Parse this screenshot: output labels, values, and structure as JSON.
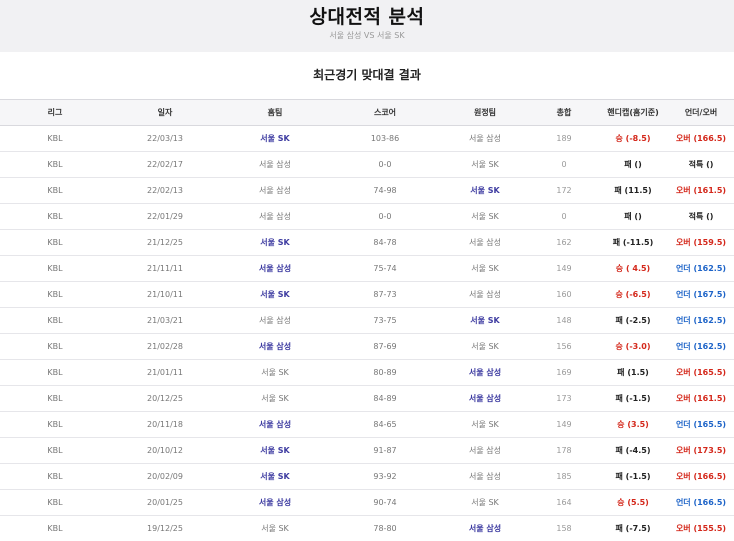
{
  "header": {
    "title": "상대전적 분석",
    "subtitle": "서울 삼성 VS 서울 SK"
  },
  "section_title": "최근경기 맞대결 결과",
  "columns": [
    "리그",
    "일자",
    "홈팀",
    "스코어",
    "원정팀",
    "총합",
    "핸디캡(홈기준)",
    "언더/오버"
  ],
  "rows": [
    {
      "league": "KBL",
      "date": "22/03/13",
      "home": "서울 SK",
      "home_strong": true,
      "score": "103-86",
      "away": "서울 삼성",
      "away_strong": false,
      "total": "189",
      "hc_result": "승",
      "hc_value": "(-8.5)",
      "hc_type": "win",
      "ou": "오버 (166.5)",
      "ou_type": "over"
    },
    {
      "league": "KBL",
      "date": "22/02/17",
      "home": "서울 삼성",
      "home_strong": false,
      "score": "0-0",
      "away": "서울 SK",
      "away_strong": false,
      "total": "0",
      "hc_result": "패",
      "hc_value": "()",
      "hc_type": "lose",
      "ou": "적특 ()",
      "ou_type": "exact"
    },
    {
      "league": "KBL",
      "date": "22/02/13",
      "home": "서울 삼성",
      "home_strong": false,
      "score": "74-98",
      "away": "서울 SK",
      "away_strong": true,
      "total": "172",
      "hc_result": "패",
      "hc_value": "(11.5)",
      "hc_type": "lose",
      "ou": "오버 (161.5)",
      "ou_type": "over"
    },
    {
      "league": "KBL",
      "date": "22/01/29",
      "home": "서울 삼성",
      "home_strong": false,
      "score": "0-0",
      "away": "서울 SK",
      "away_strong": false,
      "total": "0",
      "hc_result": "패",
      "hc_value": "()",
      "hc_type": "lose",
      "ou": "적특 ()",
      "ou_type": "exact"
    },
    {
      "league": "KBL",
      "date": "21/12/25",
      "home": "서울 SK",
      "home_strong": true,
      "score": "84-78",
      "away": "서울 삼성",
      "away_strong": false,
      "total": "162",
      "hc_result": "패",
      "hc_value": "(-11.5)",
      "hc_type": "lose",
      "ou": "오버 (159.5)",
      "ou_type": "over"
    },
    {
      "league": "KBL",
      "date": "21/11/11",
      "home": "서울 삼성",
      "home_strong": true,
      "score": "75-74",
      "away": "서울 SK",
      "away_strong": false,
      "total": "149",
      "hc_result": "승",
      "hc_value": "( 4.5)",
      "hc_type": "win",
      "ou": "언더 (162.5)",
      "ou_type": "under"
    },
    {
      "league": "KBL",
      "date": "21/10/11",
      "home": "서울 SK",
      "home_strong": true,
      "score": "87-73",
      "away": "서울 삼성",
      "away_strong": false,
      "total": "160",
      "hc_result": "승",
      "hc_value": "(-6.5)",
      "hc_type": "win",
      "ou": "언더 (167.5)",
      "ou_type": "under"
    },
    {
      "league": "KBL",
      "date": "21/03/21",
      "home": "서울 삼성",
      "home_strong": false,
      "score": "73-75",
      "away": "서울 SK",
      "away_strong": true,
      "total": "148",
      "hc_result": "패",
      "hc_value": "(-2.5)",
      "hc_type": "lose",
      "ou": "언더 (162.5)",
      "ou_type": "under"
    },
    {
      "league": "KBL",
      "date": "21/02/28",
      "home": "서울 삼성",
      "home_strong": true,
      "score": "87-69",
      "away": "서울 SK",
      "away_strong": false,
      "total": "156",
      "hc_result": "승",
      "hc_value": "(-3.0)",
      "hc_type": "win",
      "ou": "언더 (162.5)",
      "ou_type": "under"
    },
    {
      "league": "KBL",
      "date": "21/01/11",
      "home": "서울 SK",
      "home_strong": false,
      "score": "80-89",
      "away": "서울 삼성",
      "away_strong": true,
      "total": "169",
      "hc_result": "패",
      "hc_value": "(1.5)",
      "hc_type": "lose",
      "ou": "오버 (165.5)",
      "ou_type": "over"
    },
    {
      "league": "KBL",
      "date": "20/12/25",
      "home": "서울 SK",
      "home_strong": false,
      "score": "84-89",
      "away": "서울 삼성",
      "away_strong": true,
      "total": "173",
      "hc_result": "패",
      "hc_value": "(-1.5)",
      "hc_type": "lose",
      "ou": "오버 (161.5)",
      "ou_type": "over"
    },
    {
      "league": "KBL",
      "date": "20/11/18",
      "home": "서울 삼성",
      "home_strong": true,
      "score": "84-65",
      "away": "서울 SK",
      "away_strong": false,
      "total": "149",
      "hc_result": "승",
      "hc_value": "(3.5)",
      "hc_type": "win",
      "ou": "언더 (165.5)",
      "ou_type": "under"
    },
    {
      "league": "KBL",
      "date": "20/10/12",
      "home": "서울 SK",
      "home_strong": true,
      "score": "91-87",
      "away": "서울 삼성",
      "away_strong": false,
      "total": "178",
      "hc_result": "패",
      "hc_value": "(-4.5)",
      "hc_type": "lose",
      "ou": "오버 (173.5)",
      "ou_type": "over"
    },
    {
      "league": "KBL",
      "date": "20/02/09",
      "home": "서울 SK",
      "home_strong": true,
      "score": "93-92",
      "away": "서울 삼성",
      "away_strong": false,
      "total": "185",
      "hc_result": "패",
      "hc_value": "(-1.5)",
      "hc_type": "lose",
      "ou": "오버 (166.5)",
      "ou_type": "over"
    },
    {
      "league": "KBL",
      "date": "20/01/25",
      "home": "서울 삼성",
      "home_strong": true,
      "score": "90-74",
      "away": "서울 SK",
      "away_strong": false,
      "total": "164",
      "hc_result": "승",
      "hc_value": "(5.5)",
      "hc_type": "win",
      "ou": "언더 (166.5)",
      "ou_type": "under"
    },
    {
      "league": "KBL",
      "date": "19/12/25",
      "home": "서울 SK",
      "home_strong": false,
      "score": "78-80",
      "away": "서울 삼성",
      "away_strong": true,
      "total": "158",
      "hc_result": "패",
      "hc_value": "(-7.5)",
      "hc_type": "lose",
      "ou": "오버 (155.5)",
      "ou_type": "over"
    }
  ]
}
